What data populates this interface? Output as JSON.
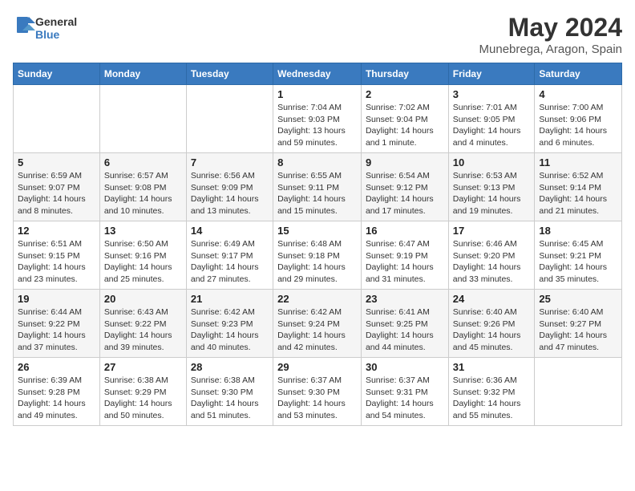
{
  "logo": {
    "general": "General",
    "blue": "Blue"
  },
  "title": "May 2024",
  "subtitle": "Munebrega, Aragon, Spain",
  "days_of_week": [
    "Sunday",
    "Monday",
    "Tuesday",
    "Wednesday",
    "Thursday",
    "Friday",
    "Saturday"
  ],
  "weeks": [
    [
      {
        "day": "",
        "info": ""
      },
      {
        "day": "",
        "info": ""
      },
      {
        "day": "",
        "info": ""
      },
      {
        "day": "1",
        "info": "Sunrise: 7:04 AM\nSunset: 9:03 PM\nDaylight: 13 hours and 59 minutes."
      },
      {
        "day": "2",
        "info": "Sunrise: 7:02 AM\nSunset: 9:04 PM\nDaylight: 14 hours and 1 minute."
      },
      {
        "day": "3",
        "info": "Sunrise: 7:01 AM\nSunset: 9:05 PM\nDaylight: 14 hours and 4 minutes."
      },
      {
        "day": "4",
        "info": "Sunrise: 7:00 AM\nSunset: 9:06 PM\nDaylight: 14 hours and 6 minutes."
      }
    ],
    [
      {
        "day": "5",
        "info": "Sunrise: 6:59 AM\nSunset: 9:07 PM\nDaylight: 14 hours and 8 minutes."
      },
      {
        "day": "6",
        "info": "Sunrise: 6:57 AM\nSunset: 9:08 PM\nDaylight: 14 hours and 10 minutes."
      },
      {
        "day": "7",
        "info": "Sunrise: 6:56 AM\nSunset: 9:09 PM\nDaylight: 14 hours and 13 minutes."
      },
      {
        "day": "8",
        "info": "Sunrise: 6:55 AM\nSunset: 9:11 PM\nDaylight: 14 hours and 15 minutes."
      },
      {
        "day": "9",
        "info": "Sunrise: 6:54 AM\nSunset: 9:12 PM\nDaylight: 14 hours and 17 minutes."
      },
      {
        "day": "10",
        "info": "Sunrise: 6:53 AM\nSunset: 9:13 PM\nDaylight: 14 hours and 19 minutes."
      },
      {
        "day": "11",
        "info": "Sunrise: 6:52 AM\nSunset: 9:14 PM\nDaylight: 14 hours and 21 minutes."
      }
    ],
    [
      {
        "day": "12",
        "info": "Sunrise: 6:51 AM\nSunset: 9:15 PM\nDaylight: 14 hours and 23 minutes."
      },
      {
        "day": "13",
        "info": "Sunrise: 6:50 AM\nSunset: 9:16 PM\nDaylight: 14 hours and 25 minutes."
      },
      {
        "day": "14",
        "info": "Sunrise: 6:49 AM\nSunset: 9:17 PM\nDaylight: 14 hours and 27 minutes."
      },
      {
        "day": "15",
        "info": "Sunrise: 6:48 AM\nSunset: 9:18 PM\nDaylight: 14 hours and 29 minutes."
      },
      {
        "day": "16",
        "info": "Sunrise: 6:47 AM\nSunset: 9:19 PM\nDaylight: 14 hours and 31 minutes."
      },
      {
        "day": "17",
        "info": "Sunrise: 6:46 AM\nSunset: 9:20 PM\nDaylight: 14 hours and 33 minutes."
      },
      {
        "day": "18",
        "info": "Sunrise: 6:45 AM\nSunset: 9:21 PM\nDaylight: 14 hours and 35 minutes."
      }
    ],
    [
      {
        "day": "19",
        "info": "Sunrise: 6:44 AM\nSunset: 9:22 PM\nDaylight: 14 hours and 37 minutes."
      },
      {
        "day": "20",
        "info": "Sunrise: 6:43 AM\nSunset: 9:22 PM\nDaylight: 14 hours and 39 minutes."
      },
      {
        "day": "21",
        "info": "Sunrise: 6:42 AM\nSunset: 9:23 PM\nDaylight: 14 hours and 40 minutes."
      },
      {
        "day": "22",
        "info": "Sunrise: 6:42 AM\nSunset: 9:24 PM\nDaylight: 14 hours and 42 minutes."
      },
      {
        "day": "23",
        "info": "Sunrise: 6:41 AM\nSunset: 9:25 PM\nDaylight: 14 hours and 44 minutes."
      },
      {
        "day": "24",
        "info": "Sunrise: 6:40 AM\nSunset: 9:26 PM\nDaylight: 14 hours and 45 minutes."
      },
      {
        "day": "25",
        "info": "Sunrise: 6:40 AM\nSunset: 9:27 PM\nDaylight: 14 hours and 47 minutes."
      }
    ],
    [
      {
        "day": "26",
        "info": "Sunrise: 6:39 AM\nSunset: 9:28 PM\nDaylight: 14 hours and 49 minutes."
      },
      {
        "day": "27",
        "info": "Sunrise: 6:38 AM\nSunset: 9:29 PM\nDaylight: 14 hours and 50 minutes."
      },
      {
        "day": "28",
        "info": "Sunrise: 6:38 AM\nSunset: 9:30 PM\nDaylight: 14 hours and 51 minutes."
      },
      {
        "day": "29",
        "info": "Sunrise: 6:37 AM\nSunset: 9:30 PM\nDaylight: 14 hours and 53 minutes."
      },
      {
        "day": "30",
        "info": "Sunrise: 6:37 AM\nSunset: 9:31 PM\nDaylight: 14 hours and 54 minutes."
      },
      {
        "day": "31",
        "info": "Sunrise: 6:36 AM\nSunset: 9:32 PM\nDaylight: 14 hours and 55 minutes."
      },
      {
        "day": "",
        "info": ""
      }
    ]
  ]
}
